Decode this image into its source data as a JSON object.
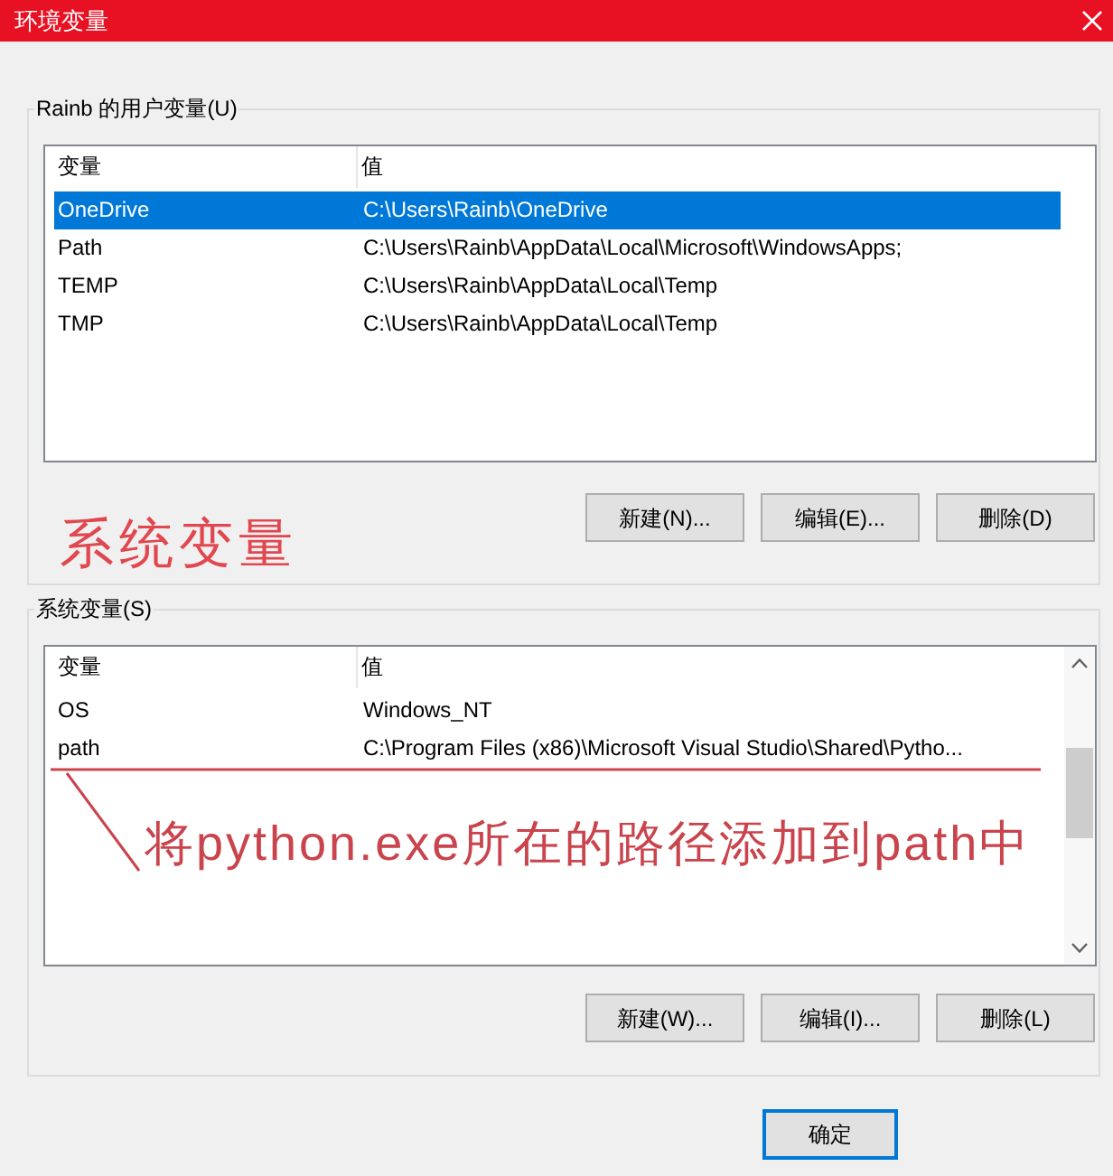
{
  "window": {
    "title": "环境变量"
  },
  "user_variables": {
    "label": "Rainb 的用户变量(U)",
    "columns": [
      "变量",
      "值"
    ],
    "rows": [
      {
        "name": "OneDrive",
        "value": "C:\\Users\\Rainb\\OneDrive",
        "selected": true
      },
      {
        "name": "Path",
        "value": "C:\\Users\\Rainb\\AppData\\Local\\Microsoft\\WindowsApps;",
        "selected": false
      },
      {
        "name": "TEMP",
        "value": "C:\\Users\\Rainb\\AppData\\Local\\Temp",
        "selected": false
      },
      {
        "name": "TMP",
        "value": "C:\\Users\\Rainb\\AppData\\Local\\Temp",
        "selected": false
      }
    ],
    "buttons": [
      "新建(N)...",
      "编辑(E)...",
      "删除(D)"
    ]
  },
  "annotation": "系统变量",
  "system_variables": {
    "label": "系统变量(S)",
    "columns": [
      "变量",
      "值"
    ],
    "rows": [
      {
        "name": "OS",
        "value": "Windows_NT",
        "selected": false
      },
      {
        "name": "path",
        "value": "C:\\Program Files (x86)\\Microsoft Visual Studio\\Shared\\Pytho...",
        "selected": false
      }
    ],
    "callout": "将python.exe所在的路径添加到path中",
    "buttons": [
      "新建(W)...",
      "编辑(I)...",
      "删除(L)"
    ]
  },
  "dialog_buttons": [
    {
      "label": "确定",
      "default": true
    }
  ]
}
